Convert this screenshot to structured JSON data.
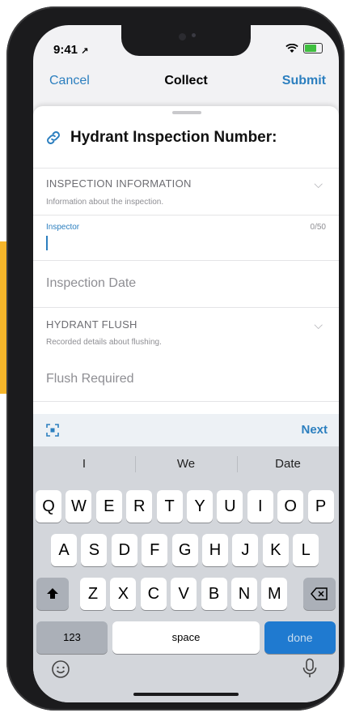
{
  "status": {
    "time": "9:41"
  },
  "nav": {
    "cancel": "Cancel",
    "title": "Collect",
    "submit": "Submit"
  },
  "form": {
    "title": "Hydrant Inspection Number:",
    "sections": [
      {
        "heading": "INSPECTION INFORMATION",
        "description": "Information about the inspection."
      },
      {
        "heading": "HYDRANT FLUSH",
        "description": "Recorded details about flushing."
      }
    ],
    "inspector": {
      "label": "Inspector",
      "counter": "0/50",
      "value": ""
    },
    "fields": [
      "Inspection Date",
      "Flush Required"
    ]
  },
  "toolbar": {
    "next": "Next",
    "scan_icon": "scan-icon"
  },
  "keyboard": {
    "suggestions": [
      "I",
      "We",
      "Date"
    ],
    "row1": [
      "Q",
      "W",
      "E",
      "R",
      "T",
      "Y",
      "U",
      "I",
      "O",
      "P"
    ],
    "row2": [
      "A",
      "S",
      "D",
      "F",
      "G",
      "H",
      "J",
      "K",
      "L"
    ],
    "row3": [
      "Z",
      "X",
      "C",
      "V",
      "B",
      "N",
      "M"
    ],
    "numbers_key": "123",
    "space_key": "space",
    "done_key": "done"
  },
  "colors": {
    "accent": "#2c7fbf",
    "done_key": "#1f7ad0",
    "side_bar": "#f5b52a"
  }
}
